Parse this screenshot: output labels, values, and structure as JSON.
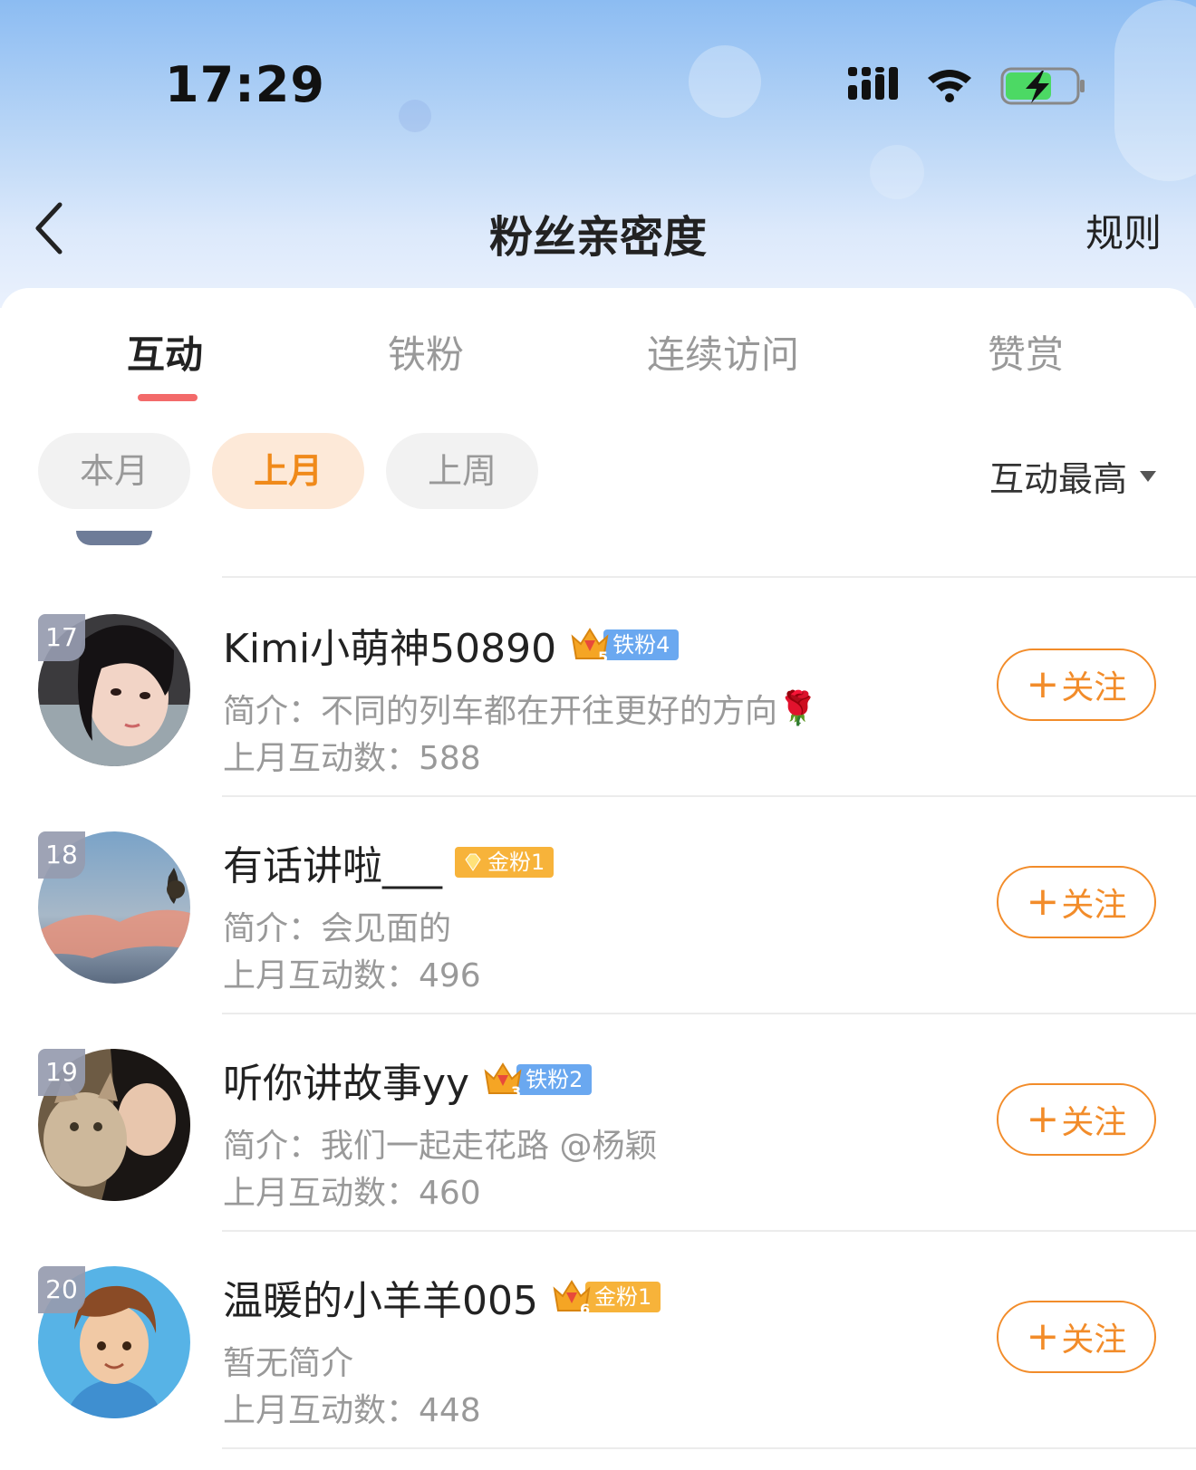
{
  "status_bar": {
    "time": "17:29"
  },
  "header": {
    "title": "粉丝亲密度",
    "rules_label": "规则"
  },
  "tabs": [
    {
      "label": "互动",
      "active": true
    },
    {
      "label": "铁粉",
      "active": false
    },
    {
      "label": "连续访问",
      "active": false
    },
    {
      "label": "赞赏",
      "active": false
    }
  ],
  "period_filters": [
    {
      "label": "本月",
      "active": false
    },
    {
      "label": "上月",
      "active": true
    },
    {
      "label": "上周",
      "active": false
    }
  ],
  "sort": {
    "label": "互动最高"
  },
  "colors": {
    "accent": "#f28c2a",
    "tab_indicator": "#f36a6a",
    "iron_badge": "#6aa8f0",
    "gold_badge": "#f7b33a"
  },
  "follow_label": "关注",
  "follow_plus": "+",
  "fans": [
    {
      "rank": "17",
      "name": "Kimi小萌神50890",
      "badge_level": "5",
      "badge_text": "铁粉4",
      "badge_type": "iron",
      "bio": "简介：不同的列车都在开往更好的方向",
      "bio_emoji": "🌹",
      "count": "上月互动数：588"
    },
    {
      "rank": "18",
      "name": "有话讲啦___",
      "badge_level": "",
      "badge_text": "金粉1",
      "badge_type": "gold",
      "bio": "简介：会见面的",
      "bio_emoji": "",
      "count": "上月互动数：496"
    },
    {
      "rank": "19",
      "name": "听你讲故事yy",
      "badge_level": "3",
      "badge_text": "铁粉2",
      "badge_type": "iron",
      "bio": "简介：我们一起走花路 @杨颖",
      "bio_emoji": "",
      "count": "上月互动数：460"
    },
    {
      "rank": "20",
      "name": "温暖的小羊羊005",
      "badge_level": "6",
      "badge_text": "金粉1",
      "badge_type": "gold",
      "bio": "暂无简介",
      "bio_emoji": "",
      "count": "上月互动数：448"
    }
  ]
}
